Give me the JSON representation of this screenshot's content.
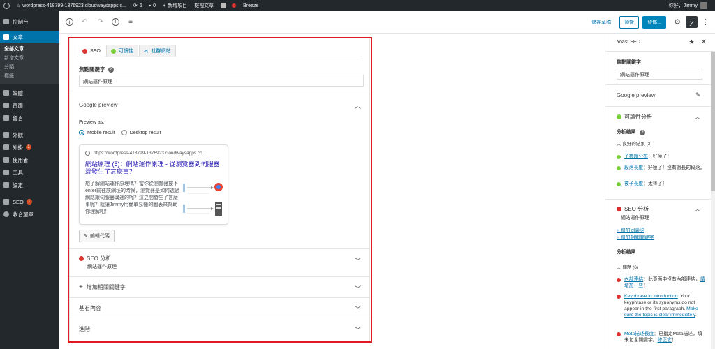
{
  "adminbar": {
    "site": "wordpress-418799-1376923.cloudwaysapps.c...",
    "updates": "6",
    "comments": "0",
    "new": "新增項目",
    "view": "檢視文章",
    "plugin": "Breeze",
    "greeting": "你好，Jimmy"
  },
  "sidebar": {
    "dashboard": "控制台",
    "posts": "文章",
    "posts_sub": [
      "全部文章",
      "新增文章",
      "分類",
      "標籤"
    ],
    "media": "媒體",
    "pages": "頁面",
    "comments": "留言",
    "appearance": "外觀",
    "plugins": "外掛",
    "plugins_badge": "1",
    "users": "使用者",
    "tools": "工具",
    "settings": "設定",
    "seo": "SEO",
    "seo_badge": "1",
    "collapse": "收合選單"
  },
  "toolbar": {
    "save_draft": "儲存草稿",
    "preview": "預覽",
    "publish": "發佈..."
  },
  "yoast": {
    "tabs": {
      "seo": "SEO",
      "readability": "可讀性",
      "social": "社群網站"
    },
    "focus_label": "焦點關鍵字",
    "focus_value": "網站運作原理",
    "google_preview": "Google preview",
    "preview_as": "Preview as:",
    "mobile": "Mobile result",
    "desktop": "Desktop result",
    "snippet": {
      "url": "https://wordpress-418799-1376923.cloudwaysapps.co...",
      "title": "網站原理 (5)：網站運作原理 - 從瀏覽器到伺服器端發生了甚麼事？",
      "desc": "想了解網站運作原理嗎？當你從瀏覽器按下enter前往該網址的時候，瀏覽器是如何透過網路跟伺服器溝通的呢？這之間發生了甚麼事呢？就讓Jimmy用簡單易懂的圖表來幫助你理解吧！"
    },
    "edit_snippet": "編輯代碼",
    "seo_analysis": "SEO 分析",
    "seo_analysis_sub": "網站運作原理",
    "add_related": "增加相關關鍵字",
    "cornerstone": "基石內容",
    "advanced": "進階"
  },
  "rightpanel": {
    "title": "Yoast SEO",
    "focus_label": "焦點關鍵字",
    "focus_value": "網站運作原理",
    "google_preview": "Google preview",
    "readability": "可讀性分析",
    "results": "分析結果",
    "good_results": "良好的結果 (3)",
    "good_items": [
      {
        "link": "子標題分布",
        "text": "：好極了！"
      },
      {
        "link": "段落長度",
        "text": "：好極了！沒有過長的段落。"
      },
      {
        "link": "被子長度",
        "text": "：太棒了！"
      }
    ],
    "seo_analysis": "SEO 分析",
    "seo_sub": "網站運作原理",
    "add_synonym": "+ 增加同義詞",
    "add_related": "+ 增加相關關鍵字",
    "results2": "分析結果",
    "problems": "問題 (6)",
    "problem_items": [
      {
        "link": "內部連結",
        "text": "：此頁面中沒有內部連結，",
        "link2": "請增加一些",
        "text2": "！"
      },
      {
        "link": "Keyphrase in introduction",
        "text": ": Your keyphrase or its synonyms do not appear in the first paragraph.",
        "link2": "Make sure the topic is clear immediately",
        "text2": "."
      },
      {
        "link": "Meta描述長度",
        "text": "：已指定Meta描述，填未包含關鍵字。",
        "link2": "修正它",
        "text2": "！"
      }
    ]
  },
  "colors": {
    "accent": "#0073aa",
    "red": "#dc3232",
    "green": "#7ad03a",
    "highlight": "#e01b24"
  }
}
